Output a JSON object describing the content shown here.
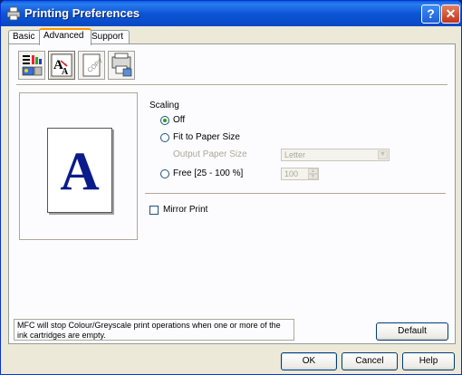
{
  "window": {
    "title": "Printing Preferences",
    "help_button": "?",
    "close_button": "✕"
  },
  "tabs": [
    {
      "label": "Basic",
      "active": false
    },
    {
      "label": "Advanced",
      "active": true
    },
    {
      "label": "Support",
      "active": false
    }
  ],
  "toolbar": {
    "icons": [
      "print-quality-icon",
      "scaling-icon",
      "watermark-icon",
      "device-options-icon"
    ],
    "selected": "scaling-icon"
  },
  "preview": {
    "letter": "A"
  },
  "scaling": {
    "heading": "Scaling",
    "off_label": "Off",
    "fit_label": "Fit to Paper Size",
    "output_label": "Output Paper Size",
    "output_value": "Letter",
    "free_label": "Free [25 - 100 %]",
    "free_value": "100",
    "selected": "Off"
  },
  "mirror": {
    "label": "Mirror Print",
    "checked": false
  },
  "message": "MFC will stop Colour/Greyscale print operations when one or more of the ink cartridges are empty.",
  "buttons": {
    "default": "Default",
    "ok": "OK",
    "cancel": "Cancel",
    "help": "Help"
  }
}
